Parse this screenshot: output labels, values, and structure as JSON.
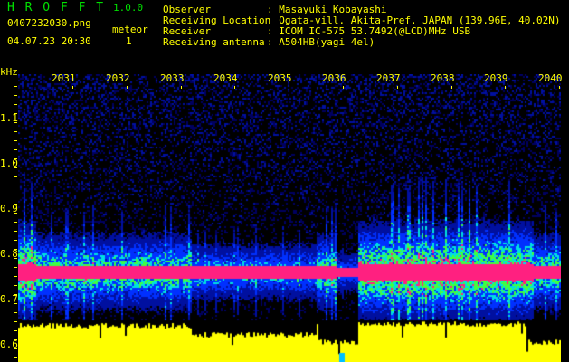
{
  "app": {
    "title": "H R O F F T",
    "version": "1.0.0"
  },
  "file": {
    "name": "0407232030.png",
    "datetime": "04.07.23 20:30"
  },
  "meteor": {
    "label": "meteor",
    "count": "1"
  },
  "info": [
    {
      "key": "Observer",
      "value": ": Masayuki Kobayashi"
    },
    {
      "key": "Receiving Location",
      "value": ": Ogata-vill. Akita-Pref. JAPAN (139.96E, 40.02N)"
    },
    {
      "key": "Receiver",
      "value": ": ICOM IC-575 53.7492(@LCD)MHz USB"
    },
    {
      "key": "Receiving antenna",
      "value": ": A504HB(yagi 4el)"
    }
  ],
  "axis": {
    "unit": "kHz",
    "y_labels": [
      "1.1",
      "1.0",
      "0.9",
      "0.8",
      "0.7",
      "0.6"
    ],
    "x_labels": [
      "2031",
      "2032",
      "2033",
      "2034",
      "2035",
      "2036",
      "2037",
      "2038",
      "2039",
      "2040"
    ]
  },
  "colors": {
    "text": "#ffff00",
    "title": "#00e000",
    "signal": "#ff2080",
    "noise": "#0010a0"
  }
}
